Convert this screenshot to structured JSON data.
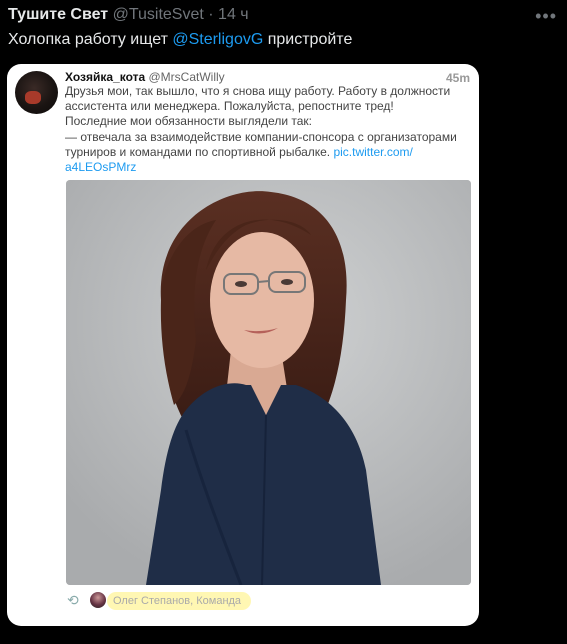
{
  "tweet": {
    "author_name": "Тушите Свет",
    "author_handle": "@TusiteSvet",
    "separator": "·",
    "time": "14 ч",
    "more_icon": "more-horizontal-icon",
    "text_prefix": "Холопка работу ищет ",
    "mention": "@SterligovG",
    "text_suffix": " пристройте"
  },
  "quoted": {
    "author_name": "Хозяйка_кота",
    "author_handle": "@MrsCatWilly",
    "time": "45m",
    "lines": [
      "Друзья мои, так вышло, что я снова ищу работу. Работу в должности",
      "ассистента или менеджера. Пожалуйста, репостните тред!",
      "Последние мои обязанности выглядели так:",
      "— отвечала за взаимодействие компании-спонсора с организаторами"
    ],
    "line5_text": "турниров и командами по спортивной рыбалке. ",
    "link_part1": "pic.twitter.com/",
    "link_part2": "a4LEOsPMrz",
    "photo_icon": "portrait-photo",
    "footer_icon": "retweet-icon",
    "footer_text": "Олег Степанов, Команда"
  }
}
